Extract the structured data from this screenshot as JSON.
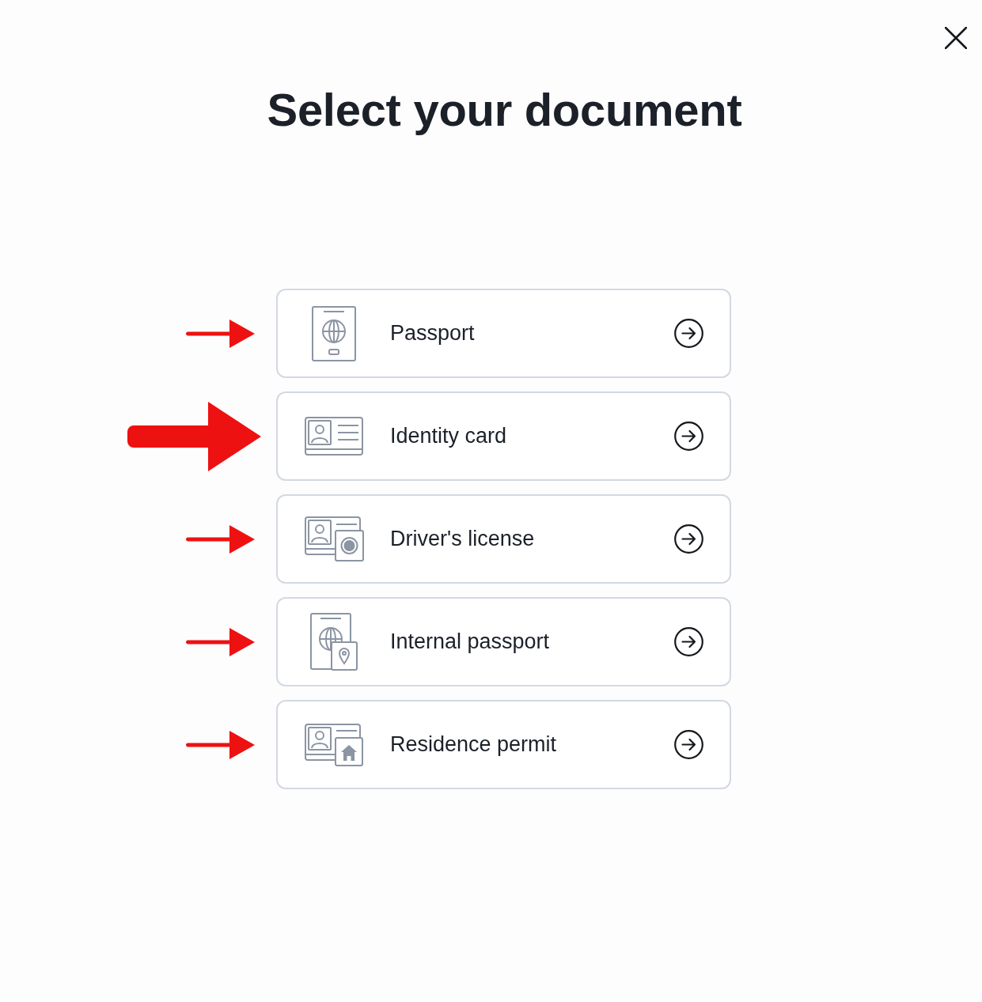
{
  "dialog": {
    "title": "Select your document"
  },
  "documents": [
    {
      "kind": "passport",
      "label": "Passport",
      "pointer": {
        "kind": "small"
      }
    },
    {
      "kind": "identity_card",
      "label": "Identity card",
      "pointer": {
        "kind": "large"
      }
    },
    {
      "kind": "drivers_license",
      "label": "Driver's license",
      "pointer": {
        "kind": "small"
      }
    },
    {
      "kind": "internal_passport",
      "label": "Internal passport",
      "pointer": {
        "kind": "small"
      }
    },
    {
      "kind": "residence_permit",
      "label": "Residence permit",
      "pointer": {
        "kind": "small"
      }
    }
  ]
}
